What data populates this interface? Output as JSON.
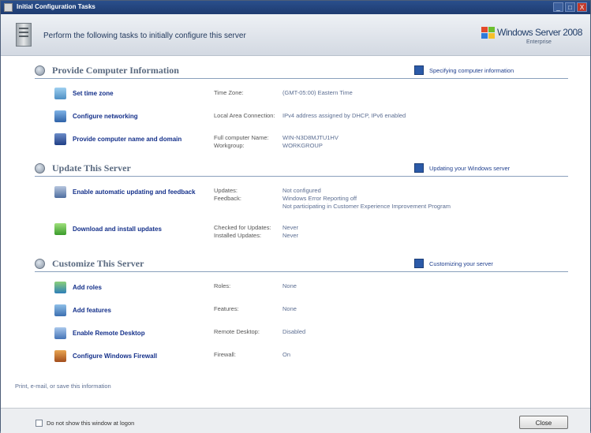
{
  "window": {
    "title": "Initial Configuration Tasks",
    "controls": {
      "minimize": "_",
      "maximize": "□",
      "close": "X"
    }
  },
  "header": {
    "instruction": "Perform the following tasks to initially configure this server",
    "brand_name": "Windows Server 2008",
    "brand_edition": "Enterprise"
  },
  "sections": [
    {
      "title": "Provide Computer Information",
      "help_link": "Specifying computer information",
      "tasks": [
        {
          "icon": "clock-icon",
          "link": "Set time zone",
          "props": [
            "Time Zone:"
          ],
          "vals": [
            "(GMT-05:00) Eastern Time"
          ]
        },
        {
          "icon": "network-icon",
          "link": "Configure networking",
          "props": [
            "Local Area Connection:"
          ],
          "vals": [
            "IPv4 address assigned by DHCP, IPv6 enabled"
          ]
        },
        {
          "icon": "computer-icon",
          "link": "Provide computer name and domain",
          "props": [
            "Full computer Name:",
            "Workgroup:"
          ],
          "vals": [
            "WIN-N3D8MJTU1HV",
            "WORKGROUP"
          ]
        }
      ]
    },
    {
      "title": "Update This Server",
      "help_link": "Updating your Windows server",
      "tasks": [
        {
          "icon": "update-icon",
          "link": "Enable automatic updating and feedback",
          "props": [
            "Updates:",
            "Feedback:"
          ],
          "vals": [
            "Not configured",
            "Windows Error Reporting off",
            "Not participating in Customer Experience Improvement Program"
          ]
        },
        {
          "icon": "download-icon",
          "link": "Download and install updates",
          "props": [
            "Checked for Updates:",
            "Installed Updates:"
          ],
          "vals": [
            "Never",
            "Never"
          ]
        }
      ]
    },
    {
      "title": "Customize This Server",
      "help_link": "Customizing your server",
      "tasks": [
        {
          "icon": "roles-icon",
          "link": "Add roles",
          "props": [
            "Roles:"
          ],
          "vals": [
            "None"
          ]
        },
        {
          "icon": "features-icon",
          "link": "Add features",
          "props": [
            "Features:"
          ],
          "vals": [
            "None"
          ]
        },
        {
          "icon": "remote-desktop-icon",
          "link": "Enable Remote Desktop",
          "props": [
            "Remote Desktop:"
          ],
          "vals": [
            "Disabled"
          ]
        },
        {
          "icon": "firewall-icon",
          "link": "Configure Windows Firewall",
          "props": [
            "Firewall:"
          ],
          "vals": [
            "On"
          ]
        }
      ]
    }
  ],
  "footer_link": "Print, e-mail, or save this information",
  "bottom": {
    "checkbox_label": "Do not show this window at logon",
    "close_label": "Close"
  },
  "colors": {
    "titlebar": "#2a4f8c",
    "link": "#14308a",
    "value": "#5c6e92",
    "section_rule": "#8aa0bc"
  }
}
